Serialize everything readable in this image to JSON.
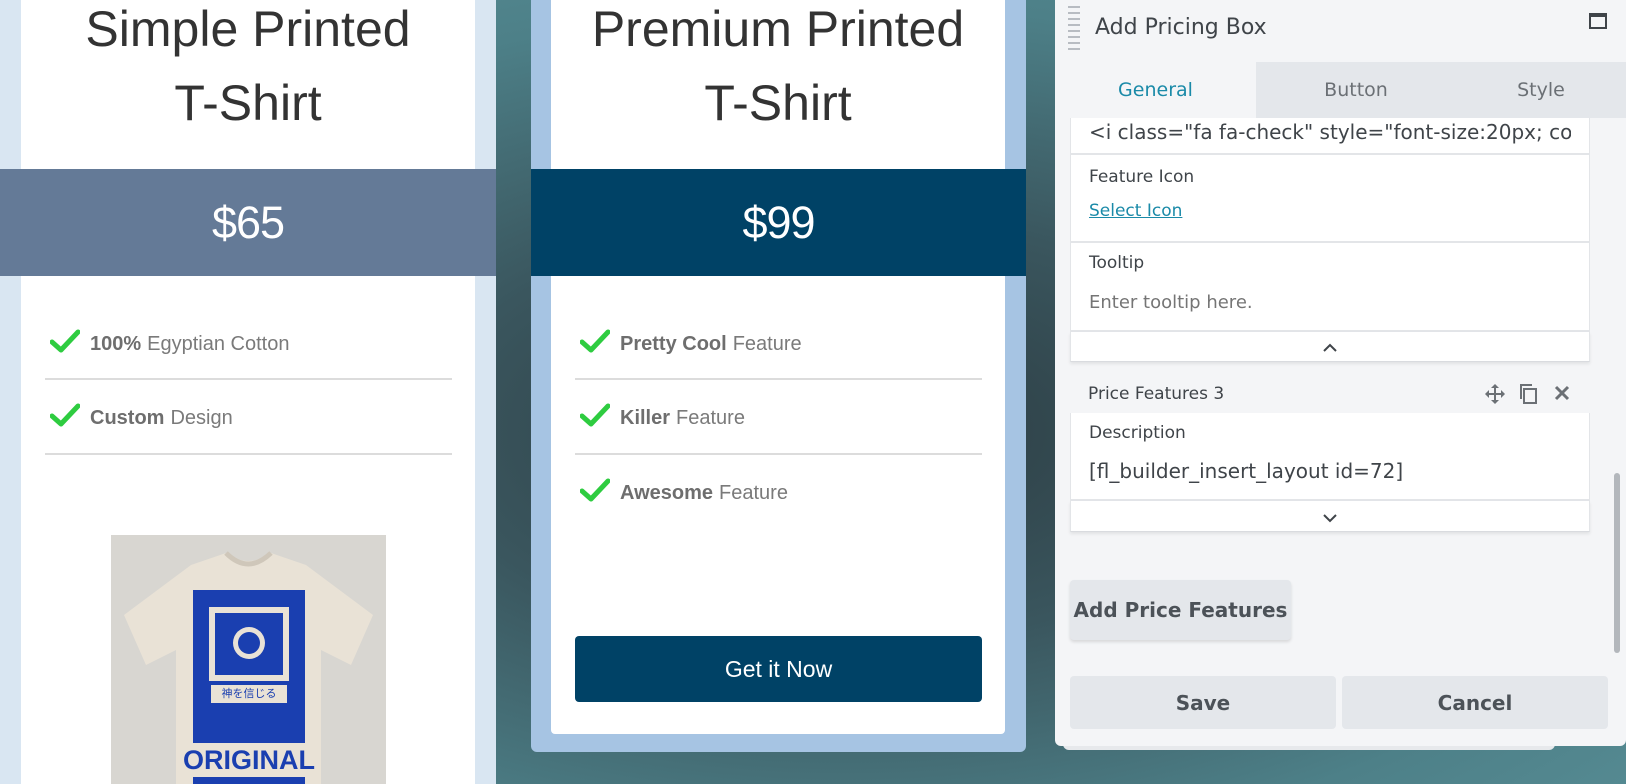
{
  "cards": [
    {
      "title_line1": "Simple Printed",
      "title_line2": "T-Shirt",
      "price": "$65",
      "features": [
        {
          "bold": "100%",
          "text": "Egyptian Cotton"
        },
        {
          "bold": "Custom",
          "text": "Design"
        }
      ],
      "image_text": "ORIGINAL",
      "image_small_text": "神を信じる"
    },
    {
      "title_line1": "Premium Printed",
      "title_line2": "T-Shirt",
      "price": "$99",
      "features": [
        {
          "bold": "Pretty Cool",
          "text": "Feature"
        },
        {
          "bold": "Killer",
          "text": "Feature"
        },
        {
          "bold": "Awesome",
          "text": "Feature"
        }
      ],
      "button_label": "Get it Now"
    }
  ],
  "panel": {
    "title": "Add Pricing Box",
    "tabs": [
      "General",
      "Button",
      "Style"
    ],
    "active_tab": "General",
    "code_field_value": "<i class=\"fa fa-check\" style=\"font-size:20px; co",
    "feature_icon_label": "Feature Icon",
    "select_icon_link": "Select Icon",
    "tooltip_label": "Tooltip",
    "tooltip_placeholder": "Enter tooltip here.",
    "price_features_header": "Price Features 3",
    "description_label": "Description",
    "description_value": "[fl_builder_insert_layout id=72]",
    "add_button": "Add Price Features",
    "save_button": "Save",
    "cancel_button": "Cancel"
  },
  "colors": {
    "check_green": "#2ecc40",
    "card1_price_bg": "#647a97",
    "card2_price_bg": "#004266",
    "tab_active": "#1a8aa8"
  }
}
